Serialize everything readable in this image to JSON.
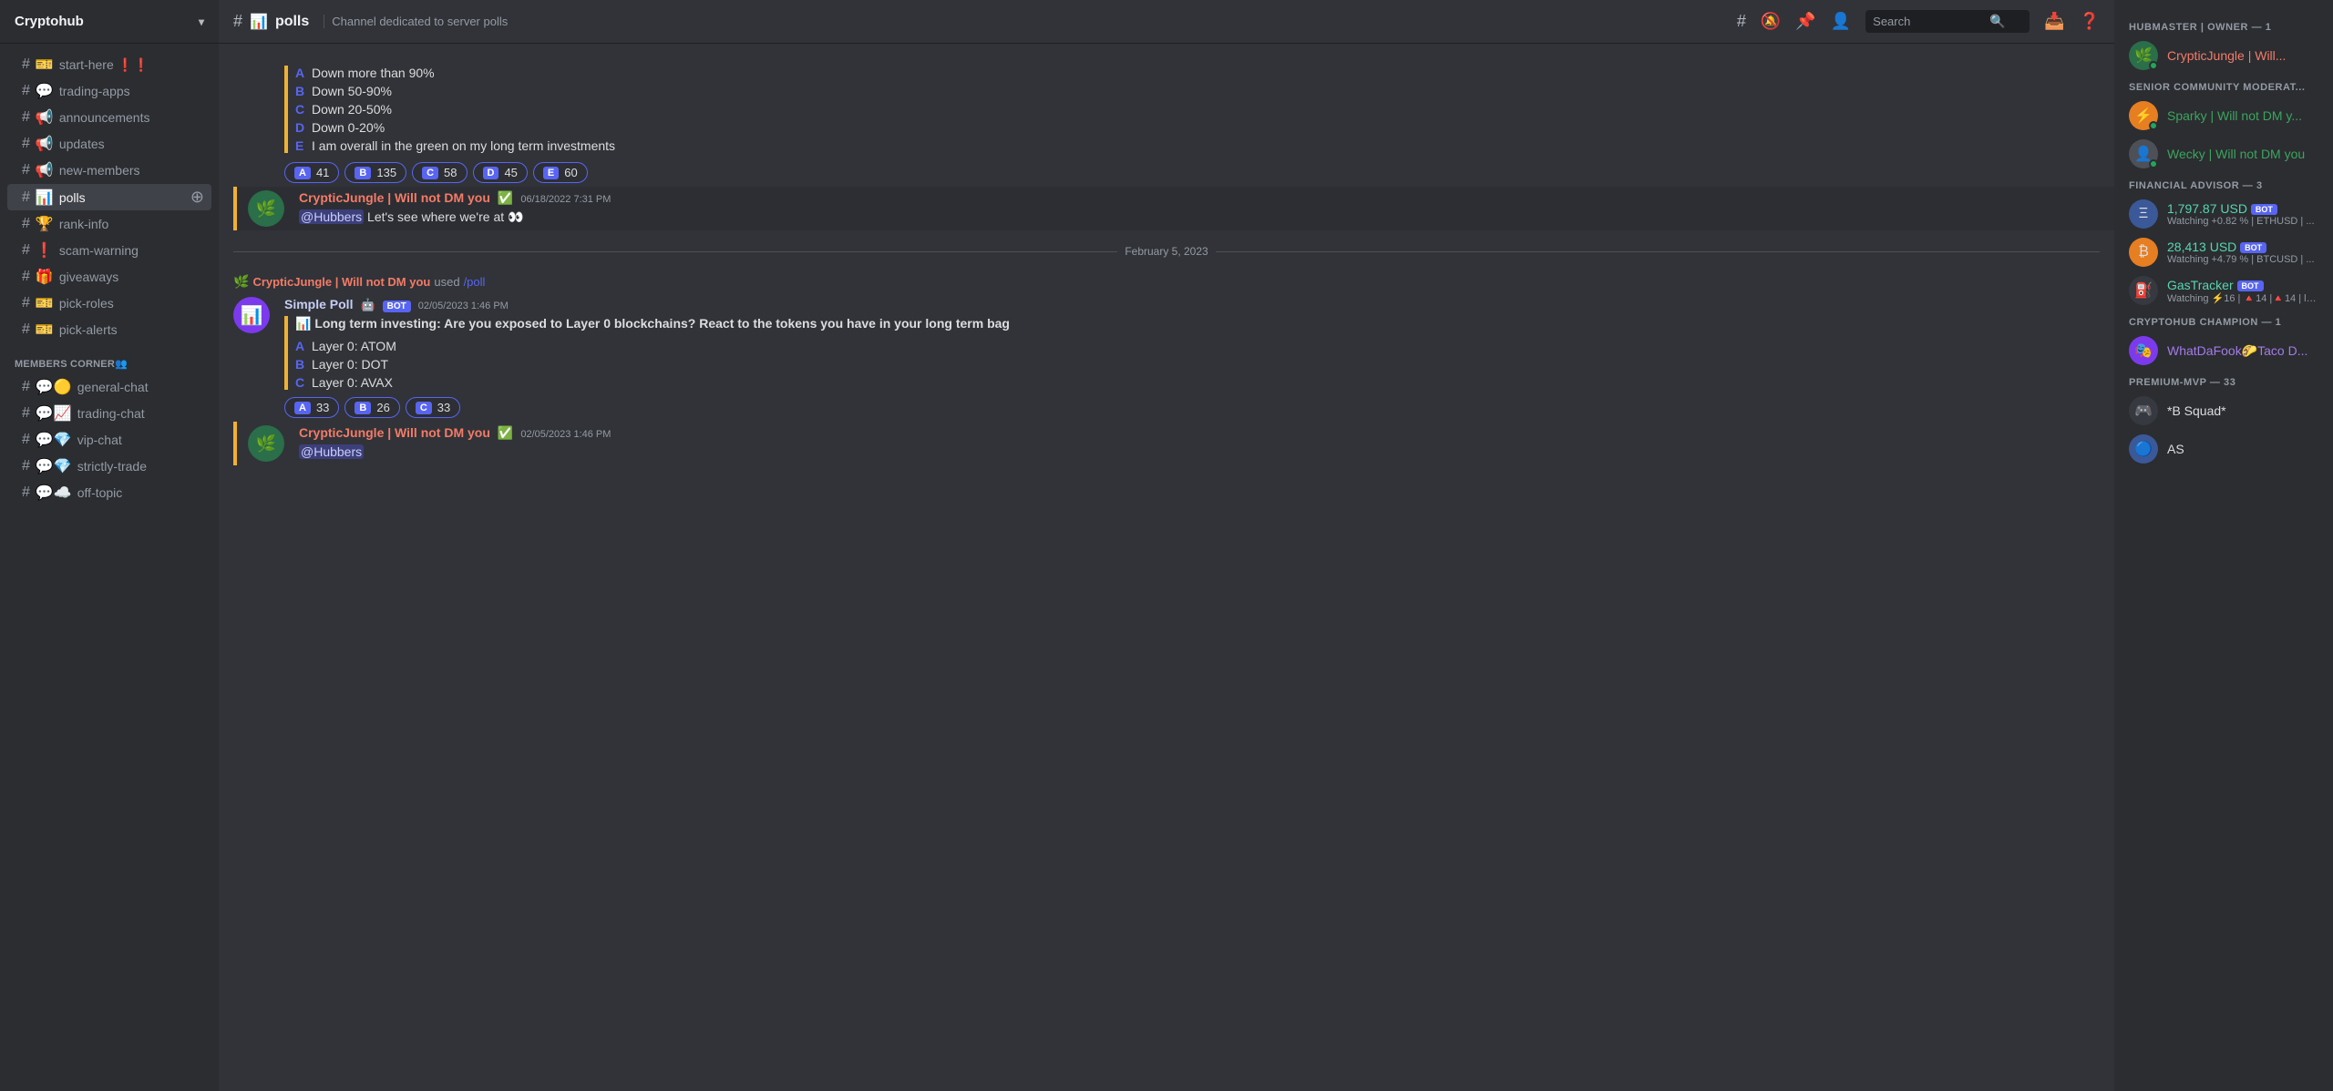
{
  "server": {
    "name": "Cryptohub",
    "icon": "🪙"
  },
  "topbar": {
    "channel_icon": "📊",
    "channel_name": "polls",
    "channel_desc": "Channel dedicated to server polls",
    "search_placeholder": "Search"
  },
  "sidebar": {
    "channels": [
      {
        "id": "start-here",
        "label": "start-here ❗❗",
        "icon": "🎫",
        "hash": "#"
      },
      {
        "id": "trading-apps",
        "label": "trading-apps",
        "icon": "💬",
        "hash": "#"
      },
      {
        "id": "announcements",
        "label": "announcements",
        "icon": "📢",
        "hash": "#"
      },
      {
        "id": "updates",
        "label": "updates",
        "icon": "📢",
        "hash": "#"
      },
      {
        "id": "new-members",
        "label": "new-members",
        "icon": "📢",
        "hash": "#"
      },
      {
        "id": "polls",
        "label": "polls",
        "icon": "📊",
        "hash": "#",
        "active": true
      },
      {
        "id": "rank-info",
        "label": "rank-info",
        "icon": "🏆",
        "hash": "#"
      },
      {
        "id": "scam-warning",
        "label": "scam-warning",
        "icon": "❗",
        "hash": "#"
      },
      {
        "id": "giveaways",
        "label": "giveaways",
        "icon": "🎁",
        "hash": "#"
      },
      {
        "id": "pick-roles",
        "label": "pick-roles",
        "icon": "🎫",
        "hash": "#"
      },
      {
        "id": "pick-alerts",
        "label": "pick-alerts",
        "icon": "🎫",
        "hash": "#"
      }
    ],
    "members_corner_label": "MEMBERS CORNER👥",
    "members_channels": [
      {
        "id": "general-chat",
        "label": "general-chat",
        "icon": "💬🟡",
        "hash": "#"
      },
      {
        "id": "trading-chat",
        "label": "trading-chat",
        "icon": "💬📈",
        "hash": "#"
      },
      {
        "id": "vip-chat",
        "label": "vip-chat",
        "icon": "💬💎",
        "hash": "#"
      },
      {
        "id": "strictly-trade",
        "label": "strictly-trade",
        "icon": "💬💎",
        "hash": "#"
      },
      {
        "id": "off-topic",
        "label": "off-topic",
        "icon": "💬☁️",
        "hash": "#"
      }
    ]
  },
  "messages": [
    {
      "id": "poll1",
      "type": "poll_reactions",
      "options": [
        {
          "letter": "A",
          "text": "Down more than 90%"
        },
        {
          "letter": "B",
          "text": "Down 50-90%"
        },
        {
          "letter": "C",
          "text": "Down 20-50%"
        },
        {
          "letter": "D",
          "text": "Down 0-20%"
        },
        {
          "letter": "E",
          "text": "I am overall in the green on my long term investments"
        }
      ],
      "reactions": [
        {
          "letter": "A",
          "count": "41"
        },
        {
          "letter": "B",
          "count": "135"
        },
        {
          "letter": "C",
          "count": "58"
        },
        {
          "letter": "D",
          "count": "45"
        },
        {
          "letter": "E",
          "count": "60"
        }
      ]
    },
    {
      "id": "msg1",
      "type": "message",
      "username": "CrypticJungle | Will not DM you",
      "username_color": "cryptic",
      "verified": true,
      "timestamp": "06/18/2022 7:31 PM",
      "avatar_color": "green-avatar",
      "avatar_emoji": "🌿",
      "content": "@Hubbers Let's see where we're at 👀",
      "bar": true,
      "bar_color": "#f0b132"
    }
  ],
  "date_divider": "February 5, 2023",
  "messages2": [
    {
      "id": "used_poll",
      "type": "system",
      "username": "CrypticJungle | Will not DM you",
      "text": "used",
      "cmd": "/poll"
    },
    {
      "id": "simplepoll",
      "type": "bot_poll",
      "username": "Simple Poll",
      "bot": true,
      "timestamp": "02/05/2023 1:46 PM",
      "poll_title": "📊 Long term investing: Are you exposed to Layer 0 blockchains? React to the tokens you have in your long term bag",
      "options": [
        {
          "letter": "A",
          "text": "Layer 0: ATOM"
        },
        {
          "letter": "B",
          "text": "Layer 0: DOT"
        },
        {
          "letter": "C",
          "text": "Layer 0: AVAX"
        }
      ],
      "reactions": [
        {
          "letter": "A",
          "count": "33"
        },
        {
          "letter": "B",
          "count": "26"
        },
        {
          "letter": "C",
          "count": "33"
        }
      ]
    },
    {
      "id": "msg2",
      "type": "message",
      "username": "CrypticJungle | Will not DM you",
      "username_color": "cryptic",
      "verified": true,
      "timestamp": "02/05/2023 1:46 PM",
      "avatar_color": "green-avatar",
      "avatar_emoji": "🌿",
      "content": "@Hubbers",
      "bar": true,
      "bar_color": "#f0b132"
    }
  ],
  "members_panel": {
    "sections": [
      {
        "title": "HUBMASTER | OWNER — 1",
        "members": [
          {
            "name": "CrypticJungle | Will...",
            "name_class": "owner",
            "avatar_color": "green-avatar",
            "avatar_emoji": "🌿",
            "status": "online",
            "has_purple_dot": true
          }
        ]
      },
      {
        "title": "SENIOR COMMUNITY MODERAT...",
        "members": [
          {
            "name": "Sparky | Will not DM y...",
            "name_class": "mod",
            "avatar_color": "orange-avatar",
            "avatar_emoji": "⚡",
            "status": "online"
          },
          {
            "name": "Wecky | Will not DM you",
            "name_class": "mod",
            "avatar_color": "gray-avatar",
            "avatar_emoji": "👤",
            "status": "online"
          }
        ]
      },
      {
        "title": "FINANCIAL ADVISOR — 3",
        "members": [
          {
            "name": "1,797.87 USD",
            "name_class": "financial",
            "subtext": "Watching +0.82 % | ETHUSD | ...",
            "avatar_color": "blue-avatar",
            "avatar_emoji": "Ξ",
            "bot": true
          },
          {
            "name": "28,413 USD",
            "name_class": "financial",
            "subtext": "Watching +4.79 % | BTCUSD | ...",
            "avatar_color": "orange-avatar",
            "avatar_emoji": "₿",
            "bot": true
          },
          {
            "name": "GasTracker",
            "name_class": "financial",
            "subtext": "Watching ⚡16 | 🔺14 |🔺14 | lh...",
            "avatar_color": "dark-avatar",
            "avatar_emoji": "⛽",
            "bot": true
          }
        ]
      },
      {
        "title": "CRYPTOHUB CHAMPION — 1",
        "members": [
          {
            "name": "WhatDaFook🌮Taco D...",
            "name_class": "champion",
            "avatar_color": "purple-avatar",
            "avatar_emoji": "🎭"
          }
        ]
      },
      {
        "title": "PREMIUM-MVP — 33",
        "members": [
          {
            "name": "*B Squad*",
            "name_class": "premium",
            "avatar_color": "dark-avatar",
            "avatar_emoji": "🎮"
          },
          {
            "name": "AS",
            "name_class": "premium",
            "avatar_color": "blue-avatar",
            "avatar_emoji": "🔵"
          }
        ]
      }
    ]
  }
}
